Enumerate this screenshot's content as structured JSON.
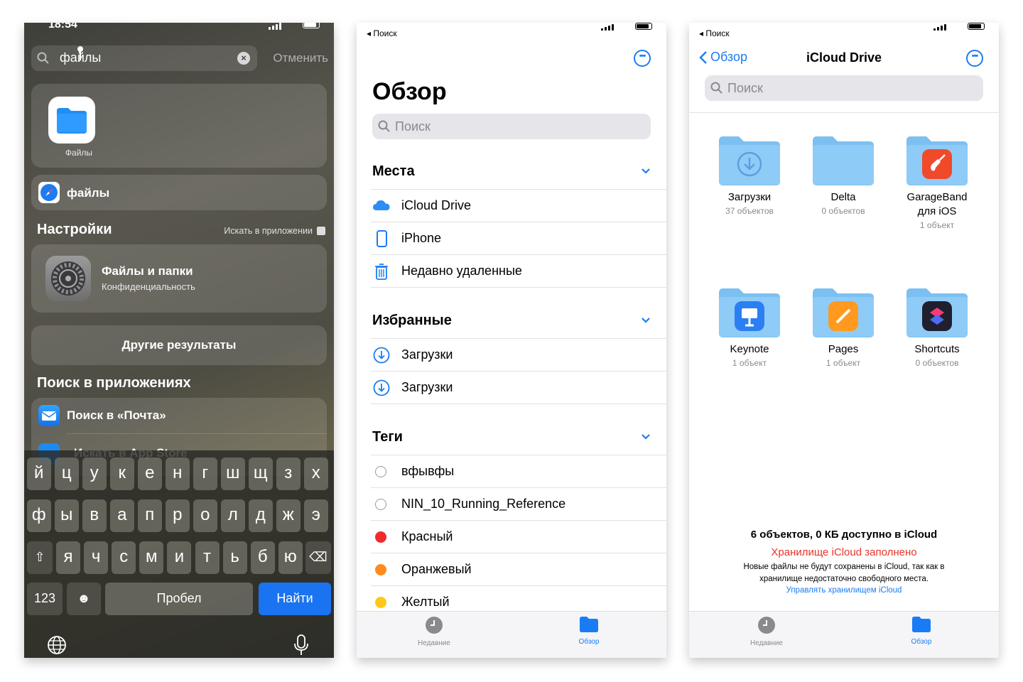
{
  "colors": {
    "accent": "#1a7cf5",
    "alert": "#e8332a",
    "find_key": "#1a73f0"
  },
  "spotlight": {
    "time": "18:54",
    "query": "файлы",
    "cancel": "Отменить",
    "app_label": "Файлы",
    "safari_suggestion": "файлы",
    "settings_section": "Настройки",
    "settings_link": "Искать в приложении",
    "settings_result_title": "Файлы и папки",
    "settings_result_sub": "Конфиденциальность",
    "other_results": "Другие результаты",
    "apps_section": "Поиск в приложениях",
    "mail_search": "Поиск в «Почта»",
    "appstore_search": "Искать в App Store"
  },
  "keyboard": {
    "row1": [
      "й",
      "ц",
      "у",
      "к",
      "е",
      "н",
      "г",
      "ш",
      "щ",
      "з",
      "х"
    ],
    "row2": [
      "ф",
      "ы",
      "в",
      "а",
      "п",
      "р",
      "о",
      "л",
      "д",
      "ж",
      "э"
    ],
    "row3": [
      "я",
      "ч",
      "с",
      "м",
      "и",
      "т",
      "ь",
      "б",
      "ю"
    ],
    "numbers": "123",
    "space": "Пробел",
    "go": "Найти"
  },
  "browse": {
    "crumb": "◂ Поиск",
    "title": "Обзор",
    "search_placeholder": "Поиск",
    "locations_header": "Места",
    "locations": [
      "iCloud Drive",
      "iPhone",
      "Недавно удаленные"
    ],
    "favorites_header": "Избранные",
    "favorites": [
      "Загрузки",
      "Загрузки"
    ],
    "tags_header": "Теги",
    "tags": [
      {
        "label": "вфывфы",
        "color": ""
      },
      {
        "label": "NIN_10_Running_Reference",
        "color": ""
      },
      {
        "label": "Красный",
        "color": "#ef2b2b"
      },
      {
        "label": "Оранжевый",
        "color": "#ff8a1c"
      },
      {
        "label": "Желтый",
        "color": "#ffc814"
      }
    ],
    "tab_recent": "Недавние",
    "tab_browse": "Обзор"
  },
  "icloud": {
    "crumb": "◂ Поиск",
    "back": "Обзор",
    "title": "iCloud Drive",
    "search_placeholder": "Поиск",
    "folders": [
      {
        "name": "Загрузки",
        "count": "37 объектов",
        "badge": "download-icon"
      },
      {
        "name": "Delta",
        "count": "0 объектов",
        "badge": ""
      },
      {
        "name": "GarageBand для iOS",
        "count": "1 объект",
        "badge": "garageband-icon"
      },
      {
        "name": "Keynote",
        "count": "1 объект",
        "badge": "keynote-icon"
      },
      {
        "name": "Pages",
        "count": "1 объект",
        "badge": "pages-icon"
      },
      {
        "name": "Shortcuts",
        "count": "0 объектов",
        "badge": "shortcuts-icon"
      }
    ],
    "summary": "6 объектов, 0 КБ доступно в iCloud",
    "full_warning": "Хранилище iCloud заполнено",
    "note": "Новые файлы не будут сохранены в iCloud, так как в хранилище недостаточно свободного места.",
    "manage_link": "Управлять хранилищем iCloud",
    "tab_recent": "Недавние",
    "tab_browse": "Обзор"
  }
}
